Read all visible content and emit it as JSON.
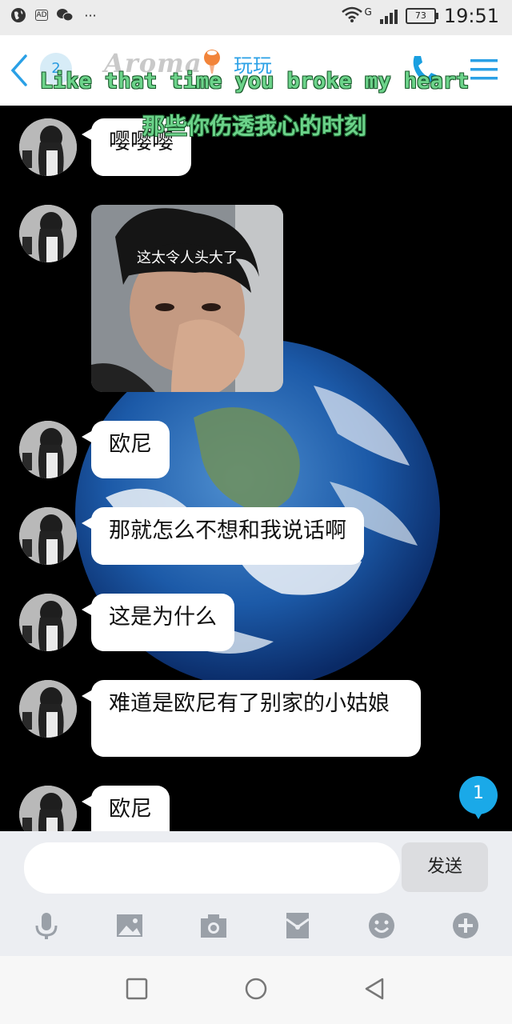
{
  "status_bar": {
    "time": "19:51",
    "battery": "73",
    "network": "G"
  },
  "header": {
    "unread_count": "2",
    "logo_text": "Aroma",
    "title": "玩玩"
  },
  "lyrics": {
    "english": "Like that time you broke my heart",
    "chinese": "那些你伤透我心的时刻"
  },
  "messages": [
    {
      "type": "text",
      "text": "嘤嘤嘤"
    },
    {
      "type": "image",
      "caption": "这太令人头大了"
    },
    {
      "type": "text",
      "text": "欧尼"
    },
    {
      "type": "text",
      "text": "那就怎么不想和我说话啊"
    },
    {
      "type": "text",
      "text": "这是为什么"
    },
    {
      "type": "text",
      "text": "难道是欧尼有了别家的小姑娘"
    },
    {
      "type": "text",
      "text": "欧尼"
    }
  ],
  "new_message_badge": "1",
  "composer": {
    "send_label": "发送",
    "placeholder": ""
  },
  "colors": {
    "accent": "#2aa0e6",
    "lyric_green": "#6cd38a",
    "badge_blue": "#1aa9e8"
  },
  "toolbar_icons": [
    "mic-icon",
    "image-icon",
    "camera-icon",
    "red-envelope-icon",
    "emoji-icon",
    "plus-icon"
  ],
  "nav_icons": [
    "recent-apps-icon",
    "home-icon",
    "back-nav-icon"
  ]
}
